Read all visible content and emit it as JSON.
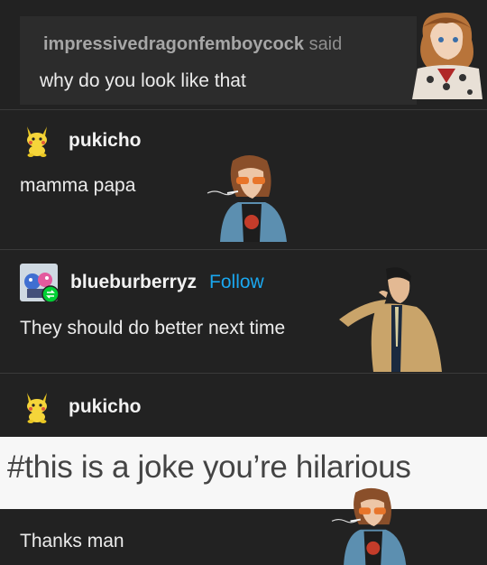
{
  "ask": {
    "name": "impressivedragonfemboycock",
    "said": "said",
    "body": "why do you look like that"
  },
  "reply1": {
    "user": "pukicho",
    "message": "mamma papa",
    "avatar_icon": "pikachu-plush-icon"
  },
  "reply2": {
    "user": "blueburberryz",
    "follow_label": "Follow",
    "message": "They should do better next time",
    "avatar_icon": "splatoon-avatar-icon",
    "badge_icon": "reblog-badge-icon"
  },
  "reply3": {
    "user": "pukicho",
    "avatar_icon": "pikachu-plush-icon"
  },
  "tag": {
    "text": "#this is a joke you’re hilarious"
  },
  "reply4": {
    "message": "Thanks man"
  },
  "colors": {
    "background": "#222222",
    "follow": "#1aa7ef",
    "tag_band": "#f7f7f7"
  }
}
